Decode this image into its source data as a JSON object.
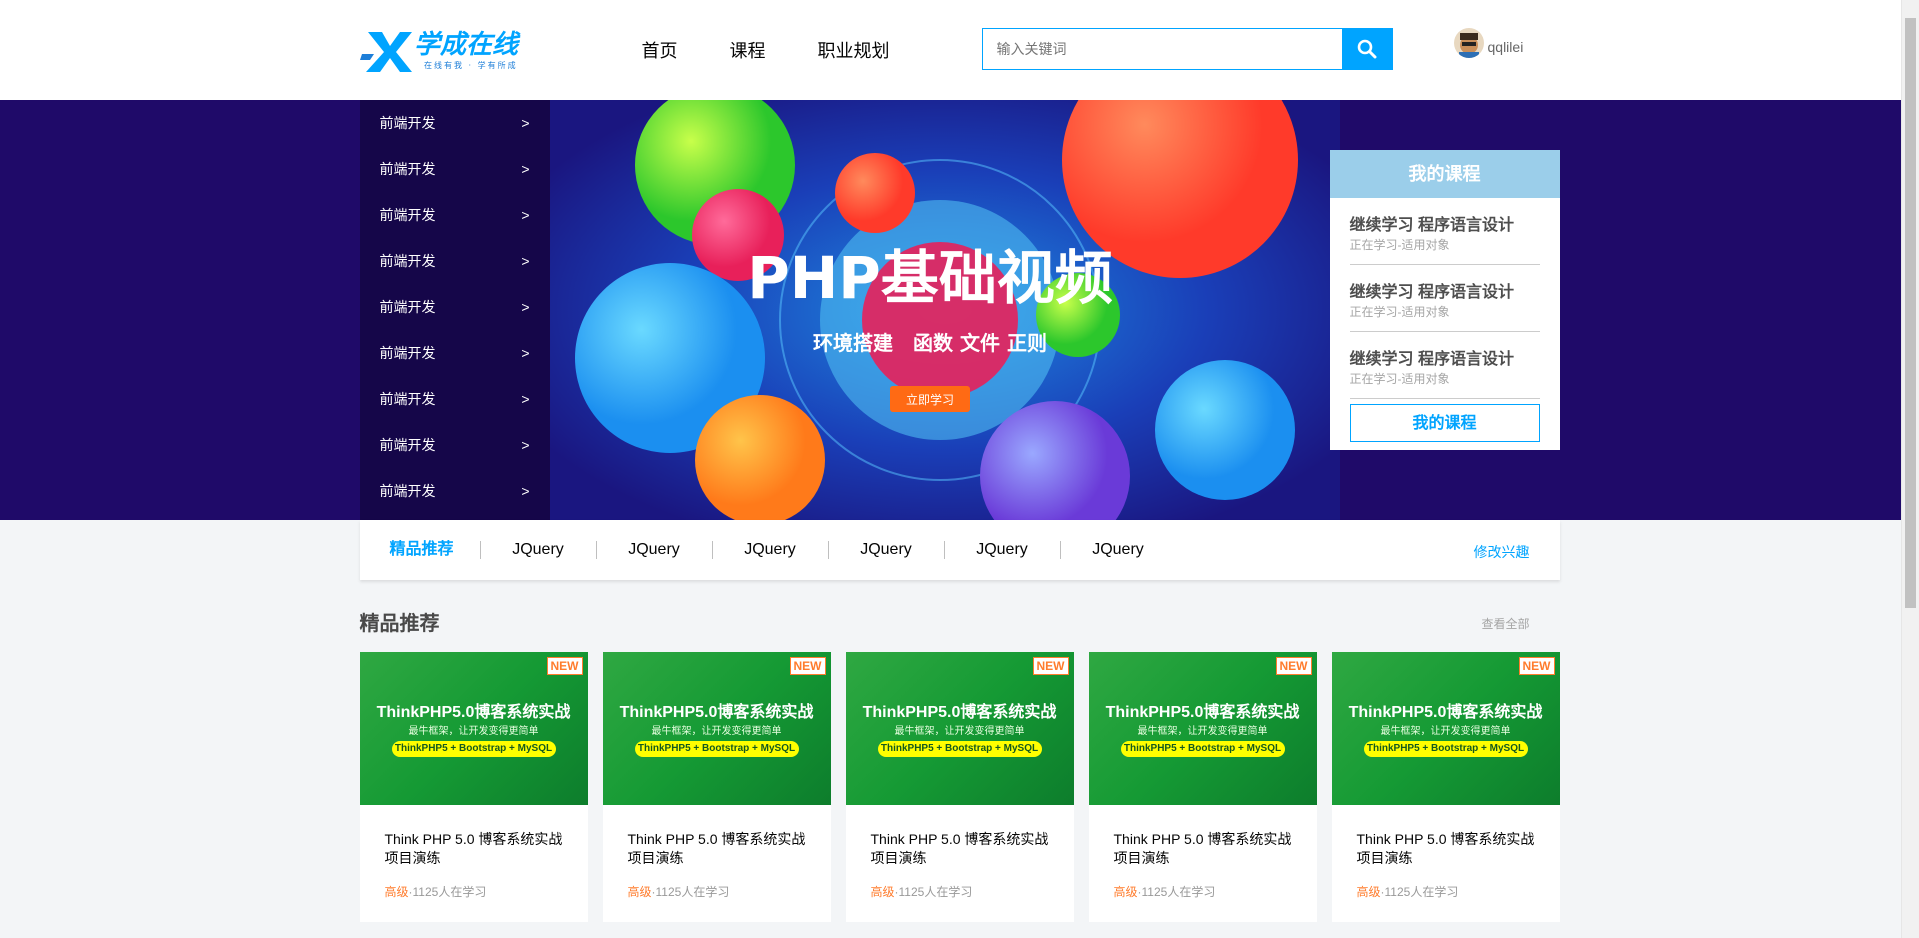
{
  "brand": {
    "logo_text": "学成在线",
    "slogan": "在线有我 · 学有所成"
  },
  "nav": [
    "首页",
    "课程",
    "职业规划"
  ],
  "search": {
    "placeholder": "输入关键词"
  },
  "user": {
    "name": "qqlilei"
  },
  "subnav": [
    {
      "label": "前端开发",
      "arrow": ">"
    },
    {
      "label": "前端开发",
      "arrow": ">"
    },
    {
      "label": "前端开发",
      "arrow": ">"
    },
    {
      "label": "前端开发",
      "arrow": ">"
    },
    {
      "label": "前端开发",
      "arrow": ">"
    },
    {
      "label": "前端开发",
      "arrow": ">"
    },
    {
      "label": "前端开发",
      "arrow": ">"
    },
    {
      "label": "前端开发",
      "arrow": ">"
    },
    {
      "label": "前端开发",
      "arrow": ">"
    }
  ],
  "banner": {
    "title": "PHP基础视频",
    "subtitle": "环境搭建　函数  文件  正则",
    "cta": "立即学习"
  },
  "my_course": {
    "title": "我的课程",
    "items": [
      {
        "title": "继续学习 程序语言设计",
        "desc": "正在学习-适用对象"
      },
      {
        "title": "继续学习 程序语言设计",
        "desc": "正在学习-适用对象"
      },
      {
        "title": "继续学习 程序语言设计",
        "desc": "正在学习-适用对象"
      }
    ],
    "button": "我的课程"
  },
  "goods": {
    "title": "精品推荐",
    "items": [
      "JQuery",
      "JQuery",
      "JQuery",
      "JQuery",
      "JQuery",
      "JQuery"
    ],
    "modify": "修改兴趣"
  },
  "section": {
    "title": "精品推荐",
    "more": "查看全部"
  },
  "cards": [
    {
      "badge": "NEW",
      "img_title": "ThinkPHP5.0博客系统实战",
      "img_sub": "最牛框架，让开发变得更简单",
      "img_tag": "ThinkPHP5 + Bootstrap + MySQL",
      "title": "Think PHP 5.0 博客系统实战项目演练",
      "level": "高级",
      "students": "·1125人在学习"
    },
    {
      "badge": "NEW",
      "img_title": "ThinkPHP5.0博客系统实战",
      "img_sub": "最牛框架，让开发变得更简单",
      "img_tag": "ThinkPHP5 + Bootstrap + MySQL",
      "title": "Think PHP 5.0 博客系统实战项目演练",
      "level": "高级",
      "students": "·1125人在学习"
    },
    {
      "badge": "NEW",
      "img_title": "ThinkPHP5.0博客系统实战",
      "img_sub": "最牛框架，让开发变得更简单",
      "img_tag": "ThinkPHP5 + Bootstrap + MySQL",
      "title": "Think PHP 5.0 博客系统实战项目演练",
      "level": "高级",
      "students": "·1125人在学习"
    },
    {
      "badge": "NEW",
      "img_title": "ThinkPHP5.0博客系统实战",
      "img_sub": "最牛框架，让开发变得更简单",
      "img_tag": "ThinkPHP5 + Bootstrap + MySQL",
      "title": "Think PHP 5.0 博客系统实战项目演练",
      "level": "高级",
      "students": "·1125人在学习"
    },
    {
      "badge": "NEW",
      "img_title": "ThinkPHP5.0博客系统实战",
      "img_sub": "最牛框架，让开发变得更简单",
      "img_tag": "ThinkPHP5 + Bootstrap + MySQL",
      "title": "Think PHP 5.0 博客系统实战项目演练",
      "level": "高级",
      "students": "·1125人在学习"
    }
  ],
  "colors": {
    "accent": "#00a4ff",
    "banner_bg": "#1f0a69",
    "orange": "#ff7c2d"
  }
}
